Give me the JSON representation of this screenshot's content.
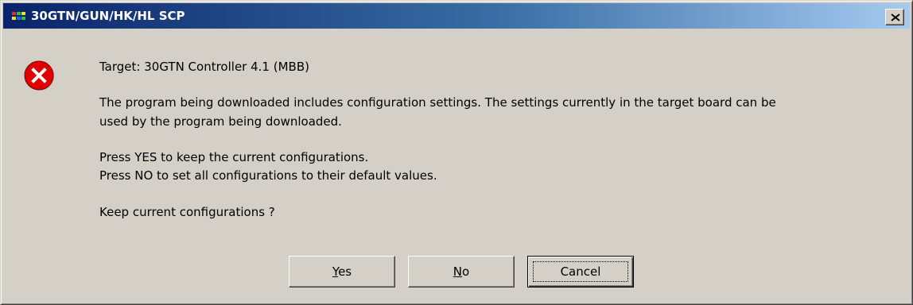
{
  "window": {
    "title": "30GTN/GUN/HK/HL SCP",
    "app_icon": "app-icon",
    "close_label": "✕"
  },
  "icon": {
    "name": "error-icon",
    "color": "#e10000"
  },
  "message": {
    "target": "Target: 30GTN Controller 4.1 (MBB)",
    "body_line1": "The program being downloaded includes configuration settings. The settings currently in the target board can be",
    "body_line2": "used by the program being downloaded.",
    "yes_hint": "Press YES to keep the current configurations.",
    "no_hint": "Press NO to set all configurations to their default values.",
    "question": "Keep current configurations ?"
  },
  "buttons": {
    "yes": {
      "mnemonic": "Y",
      "rest": "es"
    },
    "no": {
      "mnemonic": "N",
      "rest": "o"
    },
    "cancel": "Cancel"
  },
  "colors": {
    "dialog_bg": "#d4d0c8",
    "titlebar_start": "#0a246a",
    "titlebar_end": "#a6caf0"
  }
}
